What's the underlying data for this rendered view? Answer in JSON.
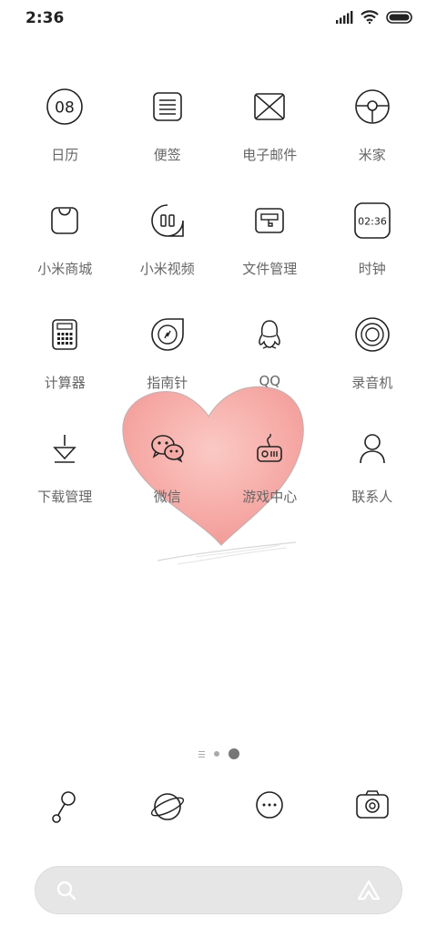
{
  "status": {
    "time": "2:36"
  },
  "apps": [
    [
      {
        "label": "日历",
        "icon_text": "08"
      },
      {
        "label": "便签"
      },
      {
        "label": "电子邮件"
      },
      {
        "label": "米家"
      }
    ],
    [
      {
        "label": "小米商城"
      },
      {
        "label": "小米视频"
      },
      {
        "label": "文件管理"
      },
      {
        "label": "时钟",
        "icon_text": "02:36"
      }
    ],
    [
      {
        "label": "计算器"
      },
      {
        "label": "指南针"
      },
      {
        "label": "QQ"
      },
      {
        "label": "录音机"
      }
    ],
    [
      {
        "label": "下载管理"
      },
      {
        "label": "微信"
      },
      {
        "label": "游戏中心"
      },
      {
        "label": "联系人"
      }
    ]
  ],
  "dock": [
    "phone-icon",
    "browser-icon",
    "messages-icon",
    "camera-icon"
  ],
  "page_indicator": {
    "pages": 2,
    "current": 2
  },
  "colors": {
    "icon_stroke": "#222222",
    "label": "#666666",
    "heart": "#f6a8a8",
    "search_bg": "#e6e6e6"
  }
}
